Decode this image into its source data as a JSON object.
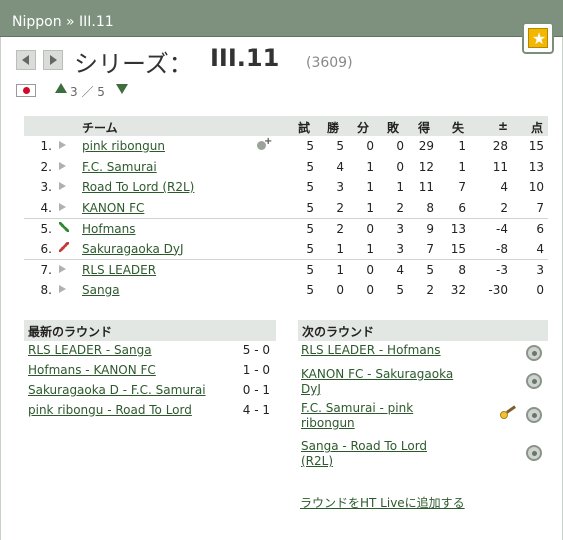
{
  "breadcrumb": "Nippon » III.11",
  "title": {
    "series_label": "シリーズ：",
    "league_name": "III.11",
    "league_id": "(3609)"
  },
  "level": {
    "text": "3 ／ 5"
  },
  "standings": {
    "headers": {
      "team": "チーム",
      "games": "試",
      "wins": "勝",
      "draws": "分",
      "losses": "敗",
      "goals_for": "得",
      "goals_against": "失",
      "diff": "±",
      "points": "点"
    },
    "rows": [
      {
        "pos": "1.",
        "trend": "same",
        "team": "pink ribongun",
        "g": "5",
        "w": "5",
        "d": "0",
        "l": "0",
        "gf": "29",
        "ga": "1",
        "diff": "28",
        "pts": "15",
        "extra_icon": true
      },
      {
        "pos": "2.",
        "trend": "same",
        "team": "F.C. Samurai",
        "g": "5",
        "w": "4",
        "d": "1",
        "l": "0",
        "gf": "12",
        "ga": "1",
        "diff": "11",
        "pts": "13"
      },
      {
        "pos": "3.",
        "trend": "same",
        "team": "Road To Lord (R2L)",
        "g": "5",
        "w": "3",
        "d": "1",
        "l": "1",
        "gf": "11",
        "ga": "7",
        "diff": "4",
        "pts": "10"
      },
      {
        "pos": "4.",
        "trend": "same",
        "team": "KANON FC",
        "g": "5",
        "w": "2",
        "d": "1",
        "l": "2",
        "gf": "8",
        "ga": "6",
        "diff": "2",
        "pts": "7"
      },
      {
        "pos": "5.",
        "trend": "up",
        "team": "Hofmans",
        "g": "5",
        "w": "2",
        "d": "0",
        "l": "3",
        "gf": "9",
        "ga": "13",
        "diff": "-4",
        "pts": "6"
      },
      {
        "pos": "6.",
        "trend": "down",
        "team": "Sakuragaoka DyJ",
        "g": "5",
        "w": "1",
        "d": "1",
        "l": "3",
        "gf": "7",
        "ga": "15",
        "diff": "-8",
        "pts": "4"
      },
      {
        "pos": "7.",
        "trend": "same",
        "team": "RLS LEADER",
        "g": "5",
        "w": "1",
        "d": "0",
        "l": "4",
        "gf": "5",
        "ga": "8",
        "diff": "-3",
        "pts": "3"
      },
      {
        "pos": "8.",
        "trend": "same",
        "team": "Sanga",
        "g": "5",
        "w": "0",
        "d": "0",
        "l": "5",
        "gf": "2",
        "ga": "32",
        "diff": "-30",
        "pts": "0"
      }
    ]
  },
  "latest_round": {
    "title": "最新のラウンド",
    "matches": [
      {
        "match": "RLS LEADER - Sanga",
        "score": "5 - 0"
      },
      {
        "match": "Hofmans - KANON FC",
        "score": "1 - 0"
      },
      {
        "match": "Sakuragaoka D - F.C. Samurai",
        "score": "0 - 1"
      },
      {
        "match": "pink ribongu - Road To Lord",
        "score": "4 - 1"
      }
    ]
  },
  "next_round": {
    "title": "次のラウンド",
    "matches": [
      {
        "line1": "RLS LEADER - Hofmans",
        "line2": ""
      },
      {
        "line1": "KANON FC - Sakuragaoka",
        "line2": "DyJ"
      },
      {
        "line1": "F.C. Samurai - pink",
        "line2": "ribongun"
      },
      {
        "line1": "Sanga - Road To Lord",
        "line2": "(R2L)"
      }
    ],
    "add_live_link": "ラウンドをHT Liveに追加する"
  },
  "colors": {
    "topbar": "#7e917e",
    "link": "#2d5a2d",
    "header_bg": "#e3e7e3",
    "badge": "#f3b700"
  },
  "icons": [
    "star-icon",
    "arrow-left-icon",
    "arrow-right-icon",
    "japan-flag-icon",
    "level-up-icon",
    "level-down-icon",
    "trend-same-icon",
    "trend-up-icon",
    "trend-down-icon",
    "magnifier-icon",
    "pencil-icon"
  ]
}
